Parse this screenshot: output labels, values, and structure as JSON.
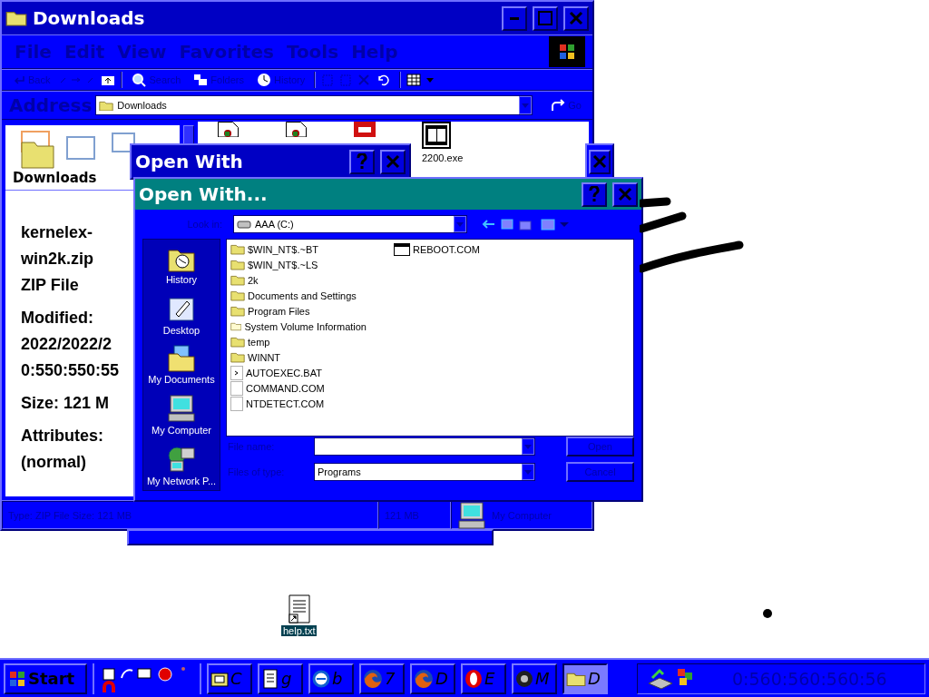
{
  "explorer": {
    "title": "Downloads",
    "menu": [
      "File",
      "Edit",
      "View",
      "Favorites",
      "Tools",
      "Help"
    ],
    "toolbar": [
      {
        "kind": "back",
        "label": "Back"
      },
      {
        "kind": "search",
        "label": "Search"
      },
      {
        "kind": "folders",
        "label": "Folders"
      },
      {
        "kind": "history",
        "label": "History"
      }
    ],
    "address_label": "Address",
    "address": "Downloads",
    "go": "Go",
    "folder_title": "Downloads",
    "details": [
      [
        "kernelex-",
        "win2k.zip",
        "ZIP File"
      ],
      [
        "Modified:",
        "2022/2022/2",
        "0:550:550:55"
      ],
      [
        "Size: 121 M"
      ],
      [
        "Attributes:",
        "(normal)"
      ]
    ],
    "files": [
      {
        "kind": "installer"
      },
      {
        "kind": "installer"
      },
      {
        "kind": "package"
      },
      {
        "kind": "archive",
        "label": "2200.exe"
      }
    ],
    "status": [
      "Type: ZIP File Size: 121 MB",
      "121 MB",
      "My Computer"
    ]
  },
  "back_dialog": {
    "title": "Open With"
  },
  "dialog": {
    "title": "Open With...",
    "look_in_label": "Look in:",
    "look_in": "AAA (C:)",
    "places": [
      {
        "kind": "history",
        "label": "History"
      },
      {
        "kind": "desktop",
        "label": "Desktop"
      },
      {
        "kind": "documents",
        "label": "My Documents"
      },
      {
        "kind": "computer",
        "label": "My Computer"
      },
      {
        "kind": "network",
        "label": "My Network P..."
      }
    ],
    "files": [
      {
        "name": "$WIN_NT$.~BT",
        "kind": "folder"
      },
      {
        "name": "$WIN_NT$.~LS",
        "kind": "folder"
      },
      {
        "name": "2k",
        "kind": "folder"
      },
      {
        "name": "Documents and Settings",
        "kind": "folder"
      },
      {
        "name": "Program Files",
        "kind": "folder"
      },
      {
        "name": "System Volume Information",
        "kind": "hidden_folder"
      },
      {
        "name": "temp",
        "kind": "folder"
      },
      {
        "name": "WINNT",
        "kind": "folder"
      },
      {
        "name": "AUTOEXEC.BAT",
        "kind": "batch"
      },
      {
        "name": "COMMAND.COM",
        "kind": "program"
      },
      {
        "name": "NTDETECT.COM",
        "kind": "program"
      },
      {
        "name": "REBOOT.COM",
        "kind": "app"
      }
    ],
    "file_name_label": "File name:",
    "files_of_type_label": "Files of type:",
    "files_of_type": "Programs",
    "buttons": [
      "Open",
      "Cancel"
    ]
  },
  "desktop_icon": {
    "label": "help.txt",
    "selected": true
  },
  "taskbar": {
    "start": "Start",
    "tasks": [
      {
        "kind": "explorer",
        "label": "C",
        "selected": false
      },
      {
        "kind": "notepad",
        "label": "g",
        "selected": false
      },
      {
        "kind": "ie",
        "label": "b",
        "selected": false
      },
      {
        "kind": "firefox",
        "label": "7",
        "selected": false
      },
      {
        "kind": "firefox",
        "label": "D",
        "selected": false
      },
      {
        "kind": "opera",
        "label": "E",
        "selected": false
      },
      {
        "kind": "media",
        "label": "M",
        "selected": false
      },
      {
        "kind": "folder",
        "label": "D",
        "selected": true
      }
    ],
    "clock": "0:560:560:560:56"
  }
}
